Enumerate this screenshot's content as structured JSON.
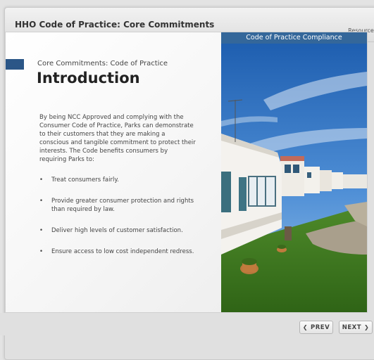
{
  "header": {
    "course_title": "HHO Code of Practice: Core Commitments",
    "resources_label": "Resources"
  },
  "slide": {
    "subtitle": "Core Commitments: Code of Practice",
    "title": "Introduction",
    "intro": "By being NCC Approved and complying with the Consumer Code of Practice, Parks can demonstrate to their customers that they are making a conscious and tangible commitment to protect their interests. The Code benefits consumers by requiring Parks to:",
    "bullets": [
      "Treat consumers fairly.",
      "Provide greater consumer protection and rights than required by law.",
      "Deliver high levels of customer satisfaction.",
      "Ensure access to low cost independent redress."
    ],
    "image_header": "Code of Practice Compliance"
  },
  "nav": {
    "prev_label": "PREV",
    "next_label": "NEXT",
    "prev_icon": "chevron-left-icon",
    "next_icon": "chevron-right-icon"
  },
  "colors": {
    "accent": "#2b5687",
    "image_header_bg": "#34679a"
  }
}
